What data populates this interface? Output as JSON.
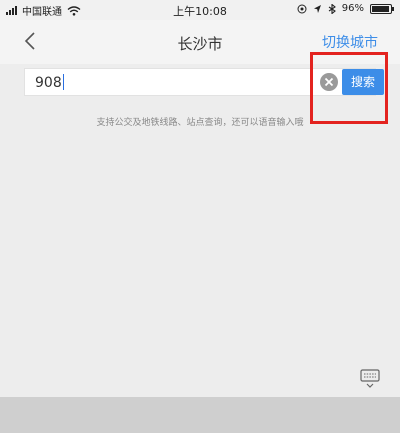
{
  "status_bar": {
    "carrier": "中国联通",
    "time": "上午10:08",
    "battery": "96%",
    "battery_level": 0.96
  },
  "navbar": {
    "back_icon": "chevron-left-icon",
    "title": "长沙市",
    "switch_city": "切换城市"
  },
  "search": {
    "value": "908",
    "clear_icon": "clear-icon",
    "button_label": "搜索"
  },
  "hint": "支持公交及地铁线路、站点查询，还可以语音输入哦",
  "icons": {
    "keyboard_toggle": "keyboard-hide-icon"
  },
  "colors": {
    "accent": "#3c8de8",
    "highlight": "#e3231f"
  }
}
